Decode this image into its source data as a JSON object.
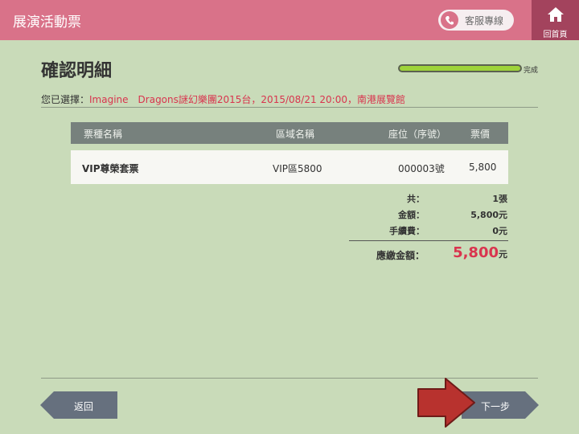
{
  "header": {
    "title": "展演活動票",
    "service_label": "客服專線",
    "home_label": "回首頁"
  },
  "page": {
    "title": "確認明細",
    "progress_label": "完成",
    "progress_fraction": 1.0
  },
  "selection": {
    "label": "您已選擇：",
    "value": "Imagine　Dragons謎幻樂團2015台，2015/08/21 20:00，南港展覽館"
  },
  "table": {
    "headers": [
      "票種名稱",
      "區域名稱",
      "座位（序號）",
      "票價"
    ],
    "rows": [
      {
        "ticket_type": "VIP尊榮套票",
        "area": "VIP區5800",
        "seat": "000003號",
        "price": "5,800"
      }
    ]
  },
  "summary": {
    "count_label": "共：",
    "count_value": "1張",
    "amount_label": "金額：",
    "amount_value": "5,800元",
    "fee_label": "手續費：",
    "fee_value": "0元",
    "total_label": "應繳金額：",
    "total_amount": "5,800",
    "total_unit": "元"
  },
  "footer": {
    "back_label": "返回",
    "next_label": "下一步"
  },
  "colors": {
    "topbar": "#d97289",
    "home_button": "#a3435d",
    "background": "#c9dbb9",
    "accent_red": "#d9344e",
    "progress_fill": "#9ed33a",
    "nav_button": "#66707e",
    "pointer_arrow": "#b8322e"
  },
  "icons": {
    "service": "phone-icon",
    "home": "home-icon",
    "pointer": "red-arrow-icon"
  }
}
